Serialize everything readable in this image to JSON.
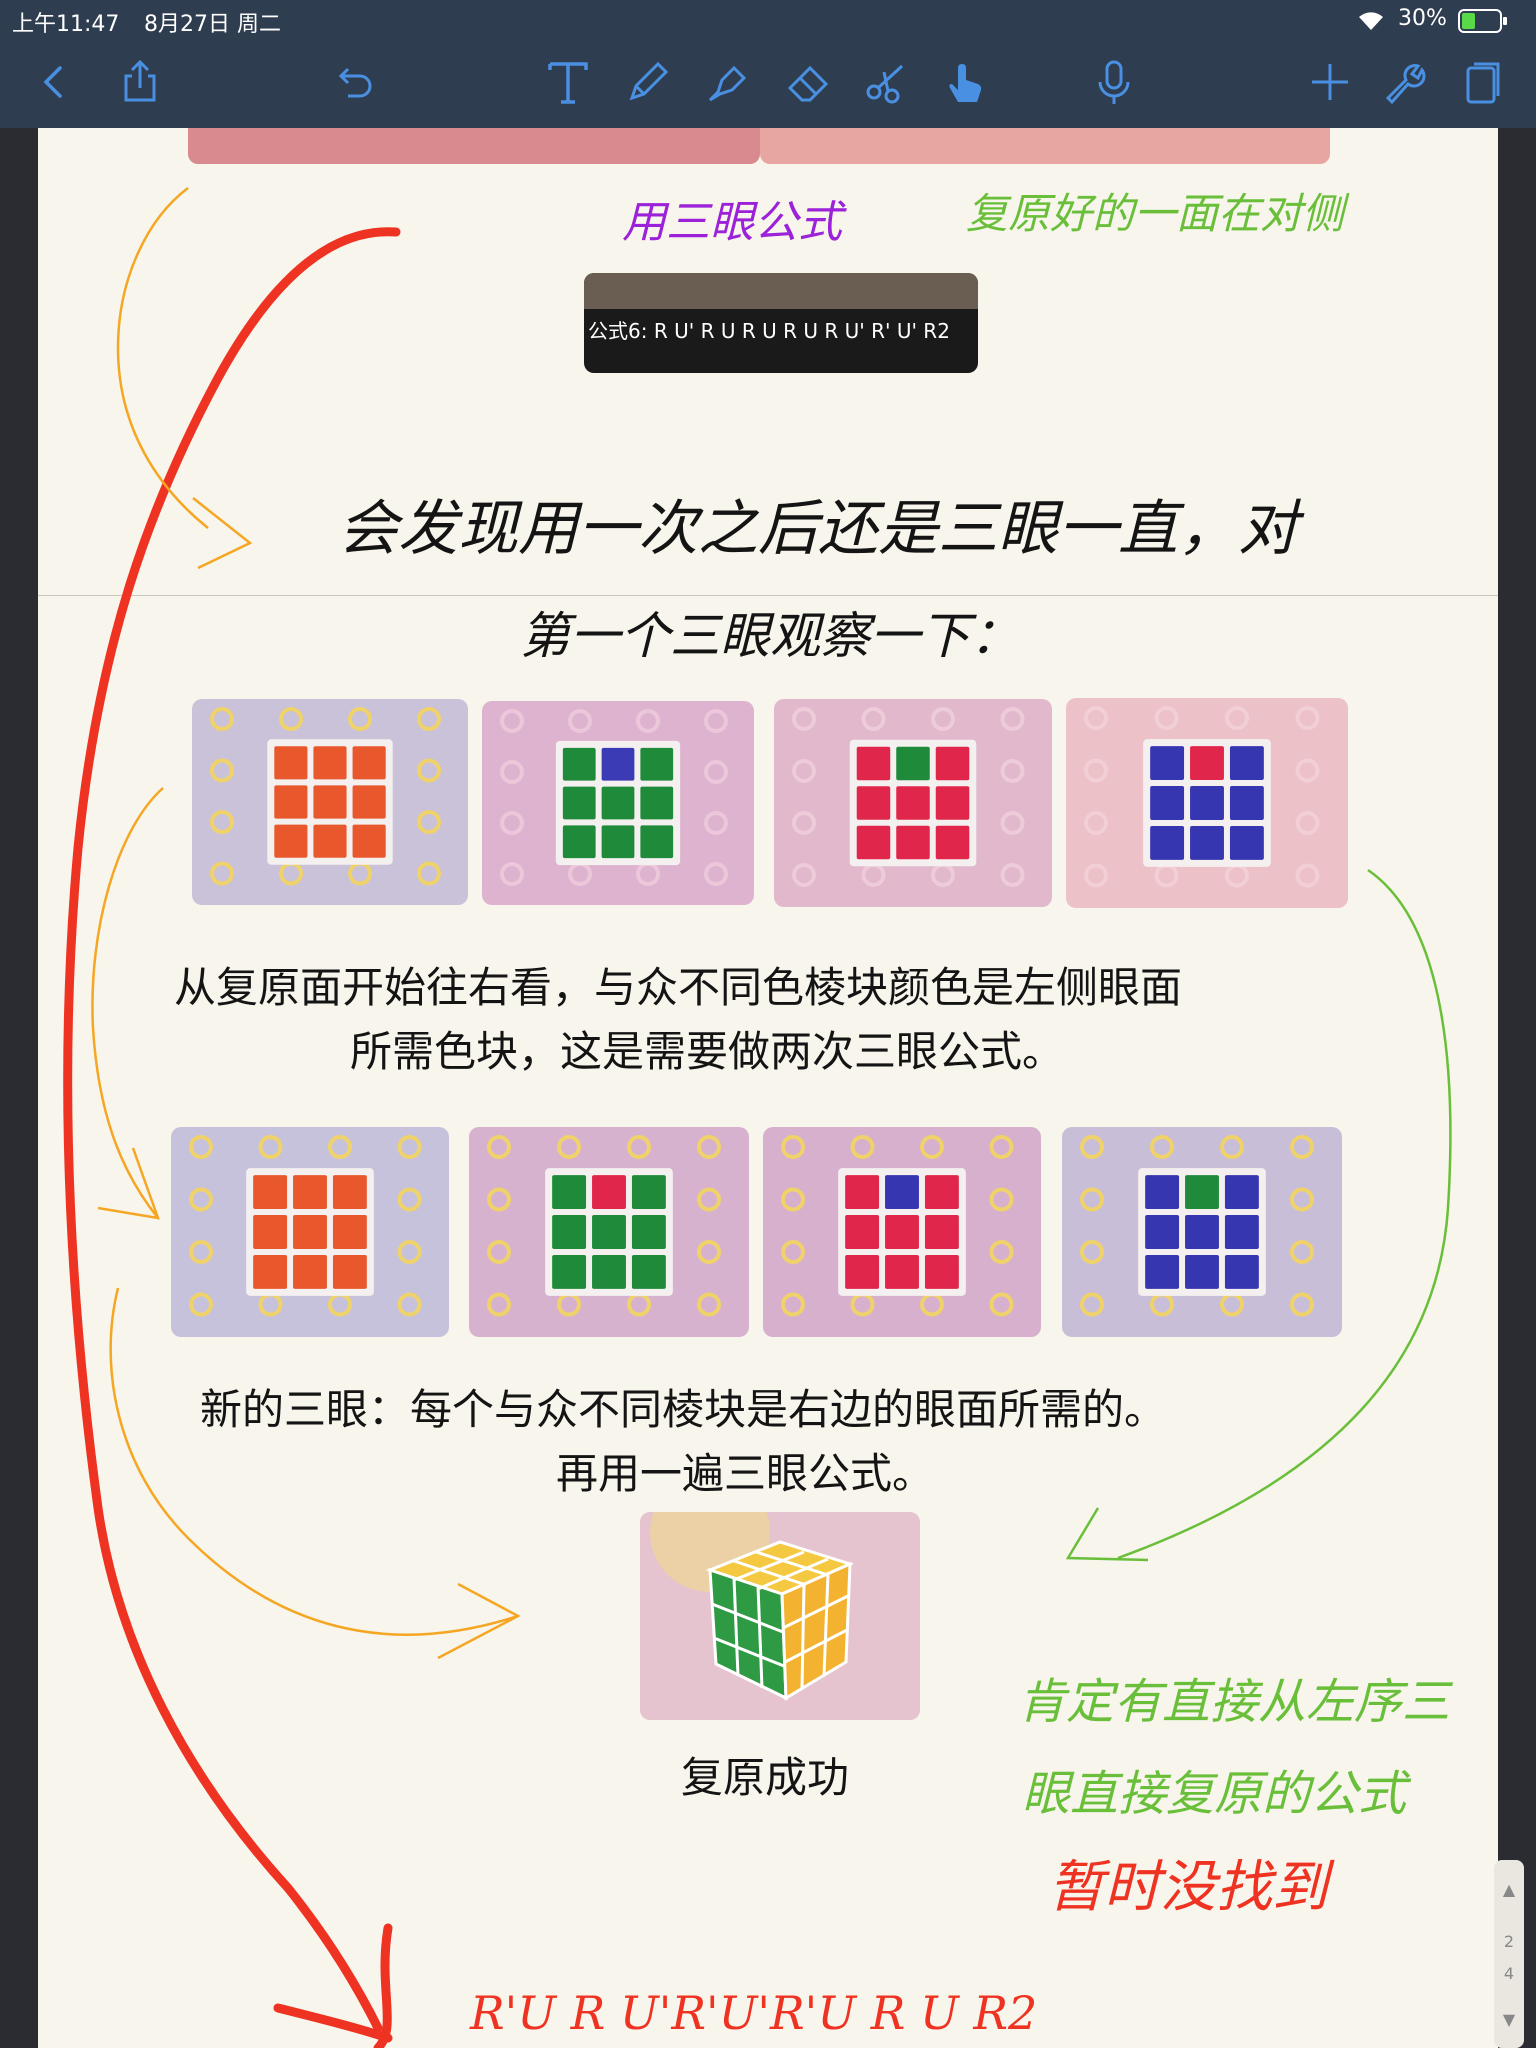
{
  "status_bar": {
    "time": "上午11:47",
    "date": "8月27日 周二",
    "battery": "30%"
  },
  "toolbar": {
    "left_icons": [
      "chevron-left-icon",
      "share-icon",
      "undo-icon"
    ],
    "tool_icons": [
      "text-tool-icon",
      "pen-icon",
      "highlighter-icon",
      "eraser-icon",
      "lasso-icon",
      "hand-pointer-icon"
    ],
    "right_icons": [
      "microphone-icon",
      "plus-icon",
      "wrench-icon",
      "pages-icon"
    ]
  },
  "notes": {
    "annotation_top_left": "用三眼公式",
    "annotation_top_right": "复原好的一面在对侧",
    "formula_caption": "公式6:  R U' R U R U R U R U' R' U' R2",
    "handwritten_line1": "会发现用一次之后还是三眼一直，对",
    "handwritten_line2": "第一个三眼观察一下：",
    "text_block1_line1": "从复原面开始往右看，与众不同色棱块颜色是左侧眼面",
    "text_block1_line2": "所需色块，这是需要做两次三眼公式。",
    "text_block2_line1": "新的三眼：每个与众不同棱块是右边的眼面所需的。",
    "text_block2_line2": "再用一遍三眼公式。",
    "success_caption": "复原成功",
    "green_note_line1": "肯定有直接从左序三",
    "green_note_line2": "眼直接复原的公式",
    "red_note": "暂时没找到",
    "bottom_formula": "R'U R U'R'U'R'U R U R2"
  },
  "scroll_indicator": {
    "current": "2",
    "total": "4"
  },
  "colors": {
    "accent": "#4a90e2",
    "toolbar_bg": "#2f3d50",
    "page_bg": "#f8f5ec",
    "red_ink": "#ee3322",
    "orange_ink": "#f5a623",
    "green_ink": "#6abf3a",
    "purple_ink": "#9b22d8"
  }
}
